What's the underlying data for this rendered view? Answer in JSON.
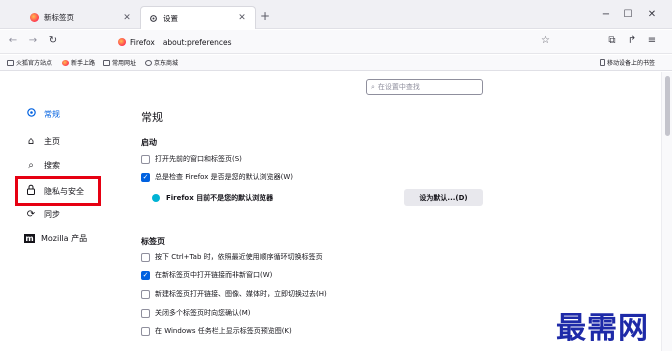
{
  "tabs": [
    {
      "label": "新标签页",
      "icon": "firefox-icon"
    },
    {
      "label": "设置",
      "icon": "gear-icon"
    }
  ],
  "window_controls": {
    "minimize": "−",
    "maximize": "☐",
    "close": "✕"
  },
  "navbar": {
    "site_label": "Firefox",
    "url": "about:preferences"
  },
  "bookmarks": [
    {
      "label": "火狐官方站点",
      "icon": "folder-icon"
    },
    {
      "label": "新手上路",
      "icon": "firefox-icon"
    },
    {
      "label": "常用网址",
      "icon": "folder-icon"
    },
    {
      "label": "京东商城",
      "icon": "globe-icon"
    }
  ],
  "bookmarks_right": {
    "label": "移动设备上的书签",
    "icon": "mobile-icon"
  },
  "search": {
    "placeholder": "在设置中查找"
  },
  "sidebar": [
    {
      "label": "常规",
      "icon": "gear-icon",
      "selected": true
    },
    {
      "label": "主页",
      "icon": "home-icon",
      "selected": false
    },
    {
      "label": "搜索",
      "icon": "search-icon",
      "selected": false
    },
    {
      "label": "隐私与安全",
      "icon": "lock-icon",
      "selected": false
    },
    {
      "label": "同步",
      "icon": "sync-icon",
      "selected": false
    },
    {
      "label": "Mozilla 产品",
      "icon": "mozilla-icon",
      "selected": false
    }
  ],
  "main": {
    "title": "常规",
    "startup": {
      "heading": "启动",
      "restore_session": {
        "label": "打开先前的窗口和标签页(S)",
        "checked": false
      },
      "check_default": {
        "label": "总是检查 Firefox 是否是您的默认浏览器(W)",
        "checked": true
      },
      "default_status": "Firefox 目前不是您的默认浏览器",
      "set_default_button": "设为默认...(D)"
    },
    "tabs": {
      "heading": "标签页",
      "items": [
        {
          "label": "按下 Ctrl+Tab 时，依照最近使用顺序循环切换标签页",
          "checked": false
        },
        {
          "label": "在新标签页中打开链接而非新窗口(W)",
          "checked": true
        },
        {
          "label": "新建标签页打开链接、图像、媒体时，立即切换过去(H)",
          "checked": false
        },
        {
          "label": "关闭多个标签页时向您确认(M)",
          "checked": false
        },
        {
          "label": "在 Windows 任务栏上显示标签页预览图(K)",
          "checked": false
        }
      ]
    }
  },
  "watermark": "最需网",
  "colors": {
    "accent": "#0061e0",
    "highlight": "#e60012",
    "watermark": "#1e2aa8"
  }
}
